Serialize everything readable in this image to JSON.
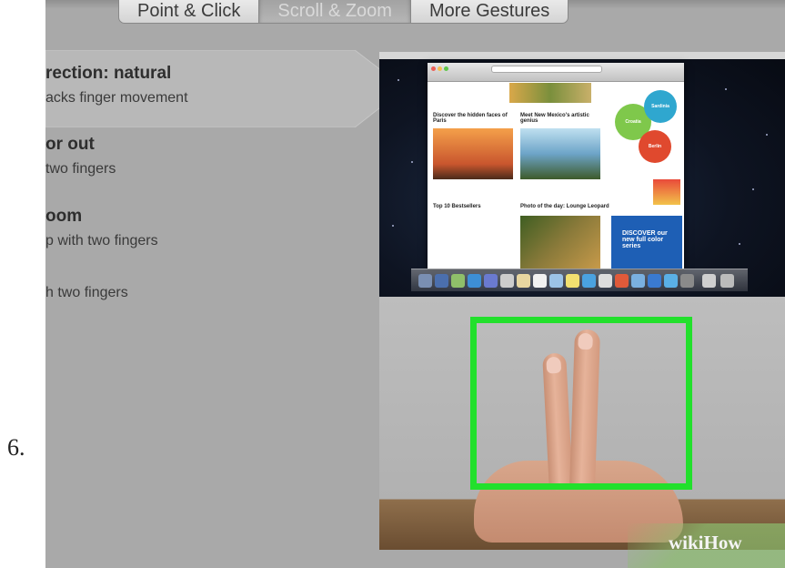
{
  "step_number": "6.",
  "tabs": [
    {
      "label": "Point & Click",
      "active": false
    },
    {
      "label": "Scroll & Zoom",
      "active": true
    },
    {
      "label": "More Gestures",
      "active": false
    }
  ],
  "gestures": [
    {
      "title": "rection: natural",
      "desc": "acks finger movement",
      "selected": true
    },
    {
      "title": "or out",
      "desc": "two fingers",
      "selected": false
    },
    {
      "title": "oom",
      "desc": "p with two fingers",
      "selected": false
    },
    {
      "title": "",
      "desc": "h two fingers",
      "selected": false
    }
  ],
  "preview": {
    "browser_sections": [
      {
        "head": "Discover the hidden faces of Paris"
      },
      {
        "head": "Meet New Mexico's artistic genius"
      },
      {
        "head": "Top 10 Bestsellers"
      },
      {
        "head": "Photo of the day: Lounge Leopard"
      }
    ],
    "circles": [
      "Croatia",
      "Sardinia",
      "Berlin"
    ],
    "ad_text": "DISCOVER our new full color series"
  },
  "watermark": {
    "text_a": "wiki",
    "text_b": "How"
  },
  "colors": {
    "panel_bg": "#a9a9a9",
    "highlight_box": "#22e02c",
    "tab_active_text": "#d9d9d9"
  }
}
